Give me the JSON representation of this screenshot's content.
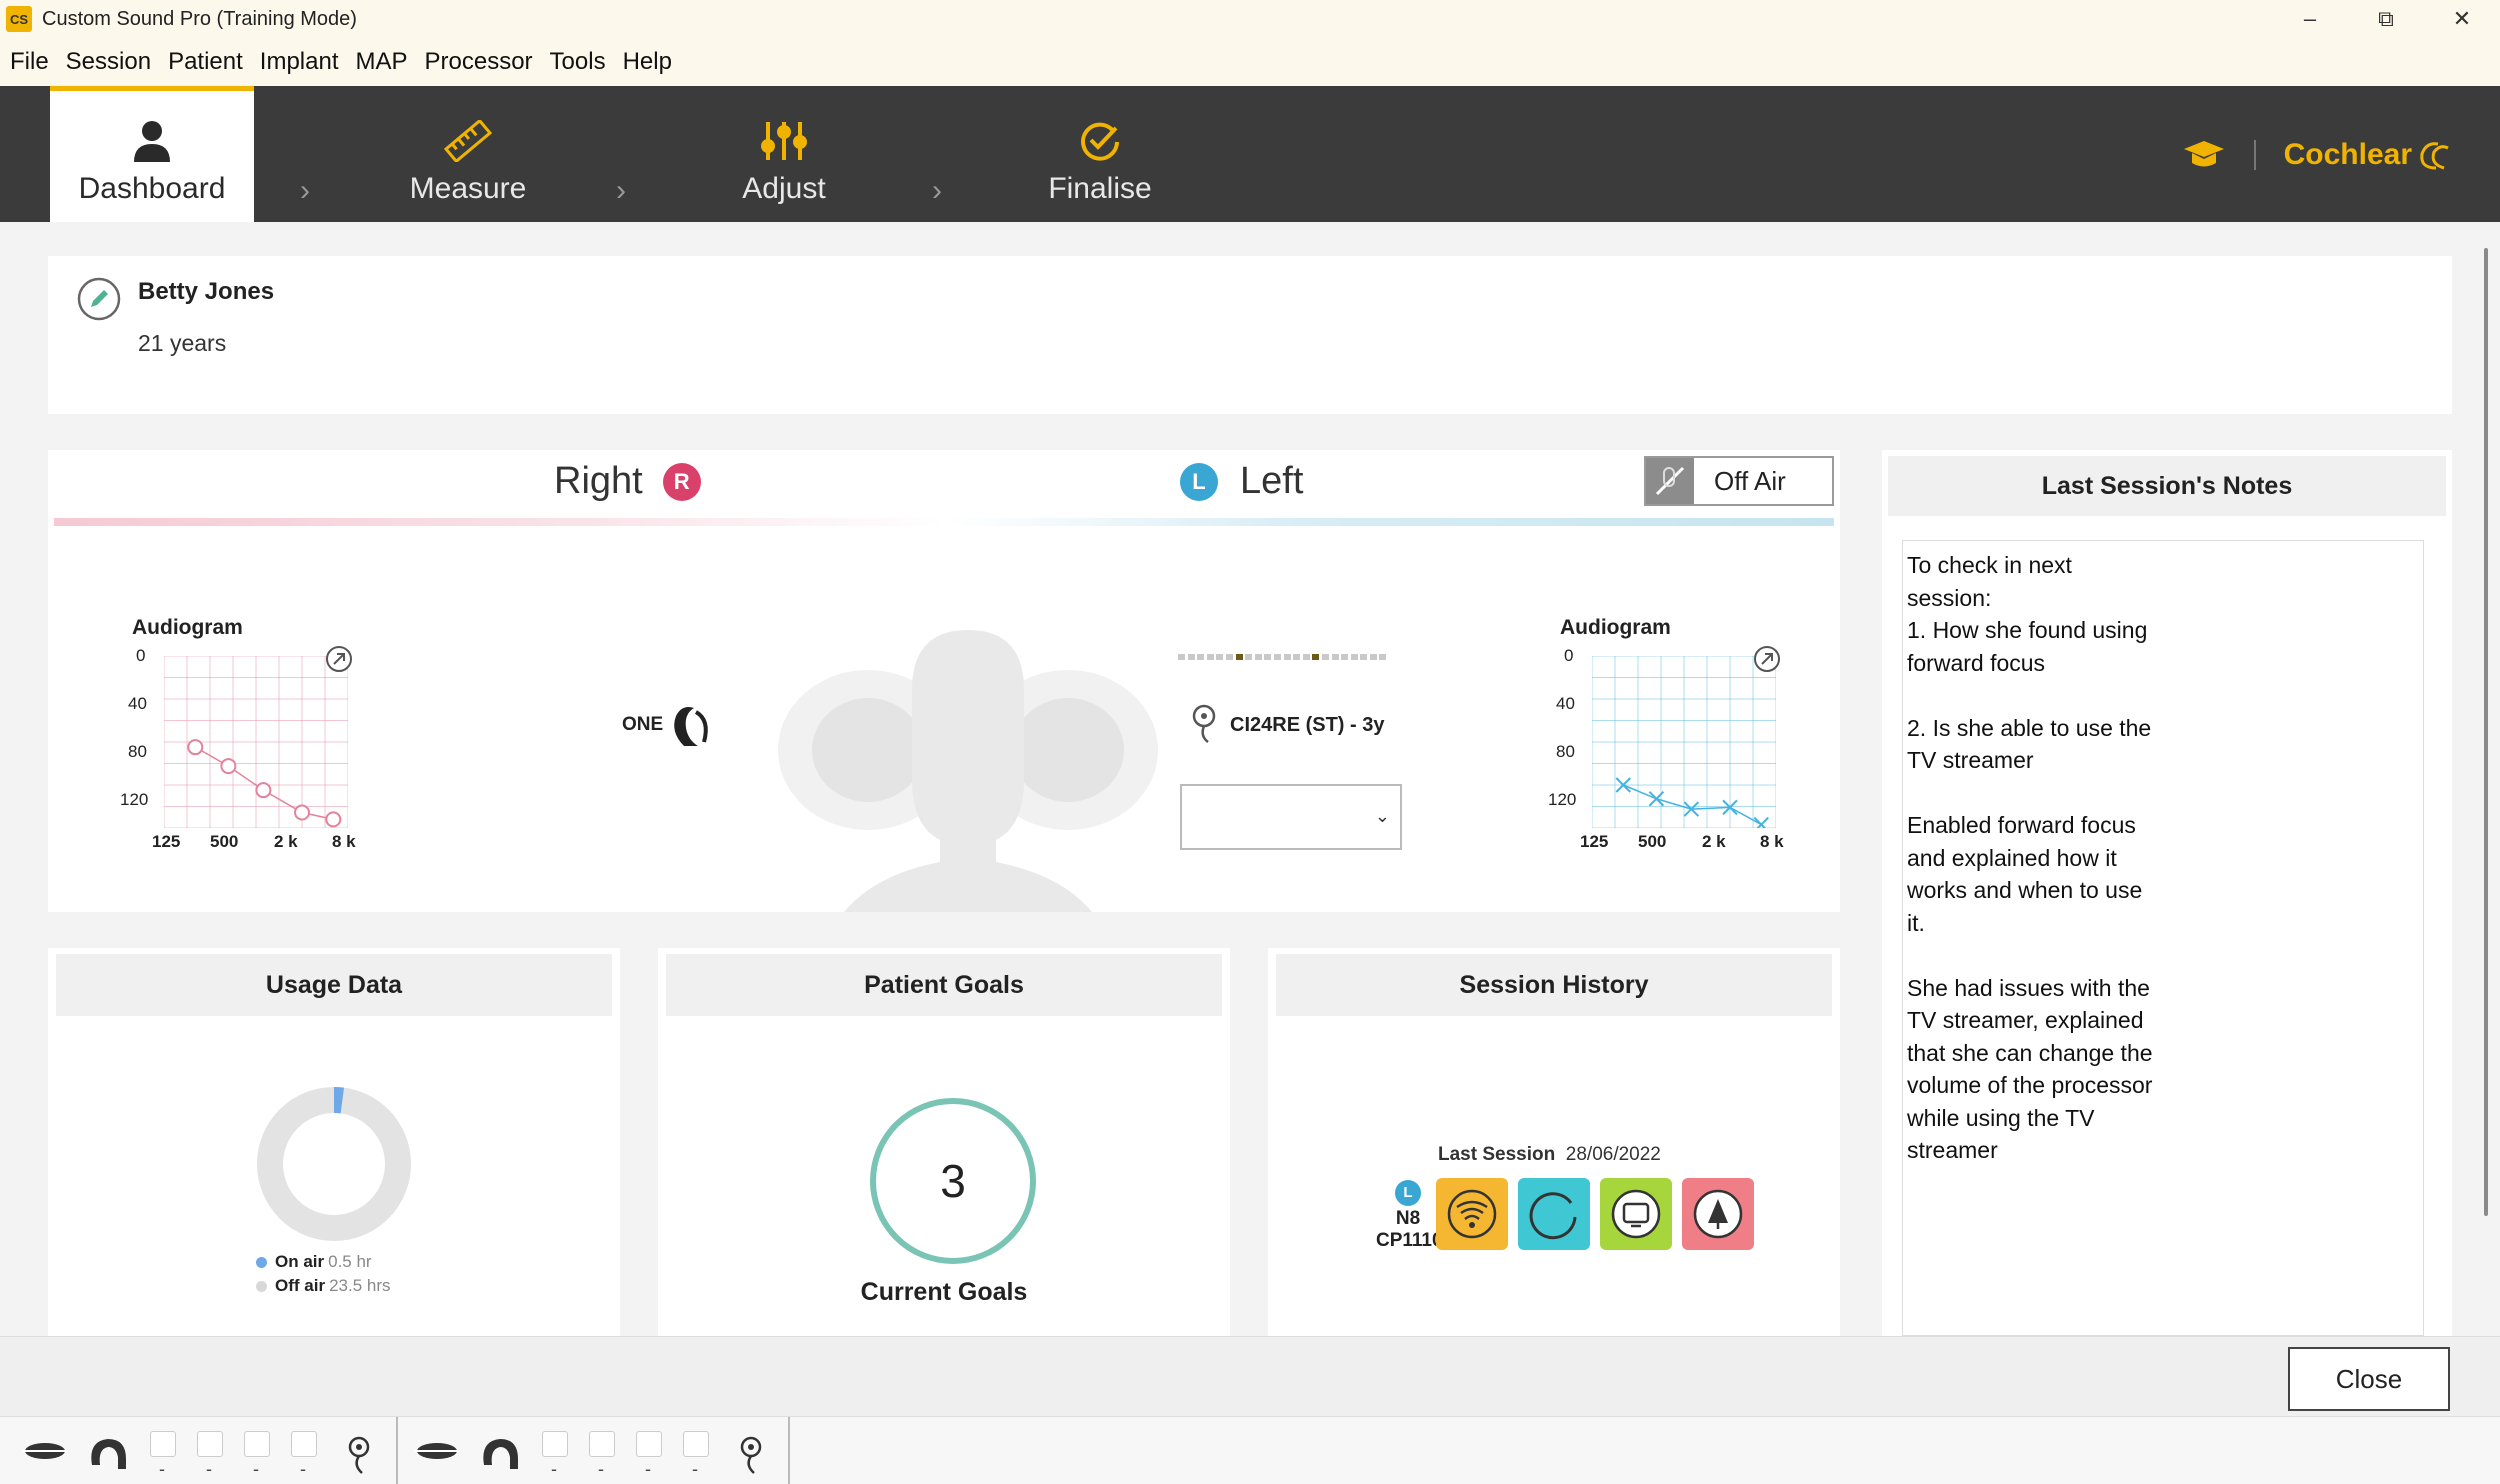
{
  "window": {
    "app_icon": "CS",
    "title": "Custom Sound Pro (Training Mode)",
    "minimize": "–",
    "maximize": "⧉",
    "close": "✕"
  },
  "menu": [
    "File",
    "Session",
    "Patient",
    "Implant",
    "MAP",
    "Processor",
    "Tools",
    "Help"
  ],
  "nav": {
    "tabs": [
      {
        "label": "Dashboard",
        "icon": "person-icon",
        "active": true
      },
      {
        "label": "Measure",
        "icon": "ruler-icon"
      },
      {
        "label": "Adjust",
        "icon": "sliders-icon"
      },
      {
        "label": "Finalise",
        "icon": "check-circle-icon"
      }
    ],
    "chevron": "›",
    "brand": "Cochlear"
  },
  "patient": {
    "name": "Betty Jones",
    "age": "21 years"
  },
  "ears": {
    "right": {
      "label": "Right",
      "badge": "R",
      "color": "#d9416b"
    },
    "left": {
      "label": "Left",
      "badge": "L",
      "color": "#3aa6d4"
    },
    "off_air_label": "Off Air",
    "right_device": "ONE",
    "left_implant": "CI24RE (ST) - 3y",
    "audiogram_title": "Audiogram",
    "y_ticks": [
      "0",
      "40",
      "80",
      "120"
    ],
    "x_ticks": [
      "125",
      "500",
      "2 k",
      "8 k"
    ],
    "right_audiogram": [
      [
        0.17,
        0.53
      ],
      [
        0.35,
        0.64
      ],
      [
        0.54,
        0.78
      ],
      [
        0.75,
        0.91
      ],
      [
        0.92,
        0.95
      ]
    ],
    "left_audiogram": [
      [
        0.17,
        0.75
      ],
      [
        0.35,
        0.83
      ],
      [
        0.54,
        0.89
      ],
      [
        0.75,
        0.88
      ],
      [
        0.92,
        0.98
      ]
    ]
  },
  "notes": {
    "title": "Last Session's Notes",
    "text": "To check in next\nsession:\n1. How she found using\nforward focus\n\n2. Is she able to use the\nTV streamer\n\nEnabled forward focus\nand explained how it\nworks and when to use\nit.\n\nShe had issues with the\nTV streamer, explained\nthat she can change the\nvolume of the processor\nwhile using the TV\nstreamer"
  },
  "usage": {
    "title": "Usage Data",
    "on_air_label": "On air",
    "on_air_value": "0.5 hr",
    "off_air_label": "Off air",
    "off_air_value": "23.5 hrs",
    "on_air_hours": 0.5,
    "total_hours": 24
  },
  "goals": {
    "title": "Patient Goals",
    "count": "3",
    "label": "Current Goals"
  },
  "history": {
    "title": "Session History",
    "last_session_label": "Last Session",
    "last_session_date": "28/06/2022",
    "ear_badge": "L",
    "processor_line1": "N8",
    "processor_line2": "CP1110",
    "tiles": [
      {
        "icon": "forward-focus-icon",
        "color": "#f5b731"
      },
      {
        "icon": "scan-icon",
        "color": "#3fc8d4"
      },
      {
        "icon": "tv-streamer-icon",
        "color": "#a7d63c"
      },
      {
        "icon": "tinnitus-icon",
        "color": "#f07e86"
      }
    ]
  },
  "footer": {
    "close_label": "Close",
    "slot_value": "-"
  }
}
